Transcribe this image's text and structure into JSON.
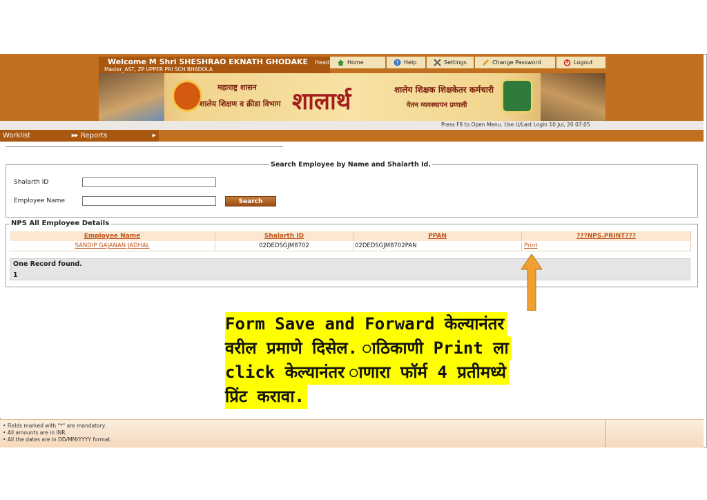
{
  "header": {
    "welcome": "Welcome M Shri SHESHRAO EKNATH GHODAKE",
    "role": "Head",
    "subtitle": "Master_AST, ZP UPPER PRI SCH BHADOLA",
    "menu": [
      {
        "label": "Home",
        "icon": "home-icon"
      },
      {
        "label": "Help",
        "icon": "help-icon"
      },
      {
        "label": "Settings",
        "icon": "settings-icon"
      },
      {
        "label": "Change Password",
        "icon": "pencil-icon"
      },
      {
        "label": "Logout",
        "icon": "power-icon"
      }
    ]
  },
  "banner": {
    "line1": "महाराष्ट्र शासन",
    "line2": "शालेय शिक्षण व क्रीडा विभाग",
    "logo": "शालार्थ",
    "line3": "शालेय शिक्षक शिक्षकेतर कर्मचारी",
    "line4": "वेतन व्यवस्थापन प्रणाली"
  },
  "status_line": "Press F8 to Open Menu. Use U/Last Login 10 Jul, 20 07:05",
  "nav": {
    "worklist": "Worklist",
    "reports": "Reports"
  },
  "search": {
    "legend": "Search Employee by Name and Shalarth Id.",
    "shalarth_label": "Shalarth ID",
    "shalarth_value": "",
    "employee_label": "Employee Name",
    "employee_value": "",
    "button": "Search"
  },
  "nps": {
    "legend": "NPS All Employee Details",
    "columns": [
      "Employee Name",
      "Shalarth ID",
      "PPAN",
      "???NPS.PRINT???"
    ],
    "rows": [
      {
        "employee_name": "SANDIP GAJANAN JADHAL",
        "shalarth_id": "02DEDSGJM8702",
        "ppan": "02DEDSGJM8702PAN",
        "print": "Print"
      }
    ],
    "found_text": "One Record found.",
    "page": "1"
  },
  "footer": {
    "lines": [
      "Fields marked with \"*\" are mandatory.",
      "All amounts are in INR.",
      "All the dates are in DD/MM/YYYY format."
    ]
  },
  "annotation": {
    "lines": [
      "Form Save and Forward केल्यानंतर",
      "वरील प्रमाणे दिसेल. ाठिकाणी Print ला",
      "click केल्यानंतर ाणारा फॉर्म 4 प्रतीमध्ये",
      "प्रिंट करावा."
    ],
    "highlight_color": "#ffff00",
    "arrow_color": "#f0a030"
  }
}
